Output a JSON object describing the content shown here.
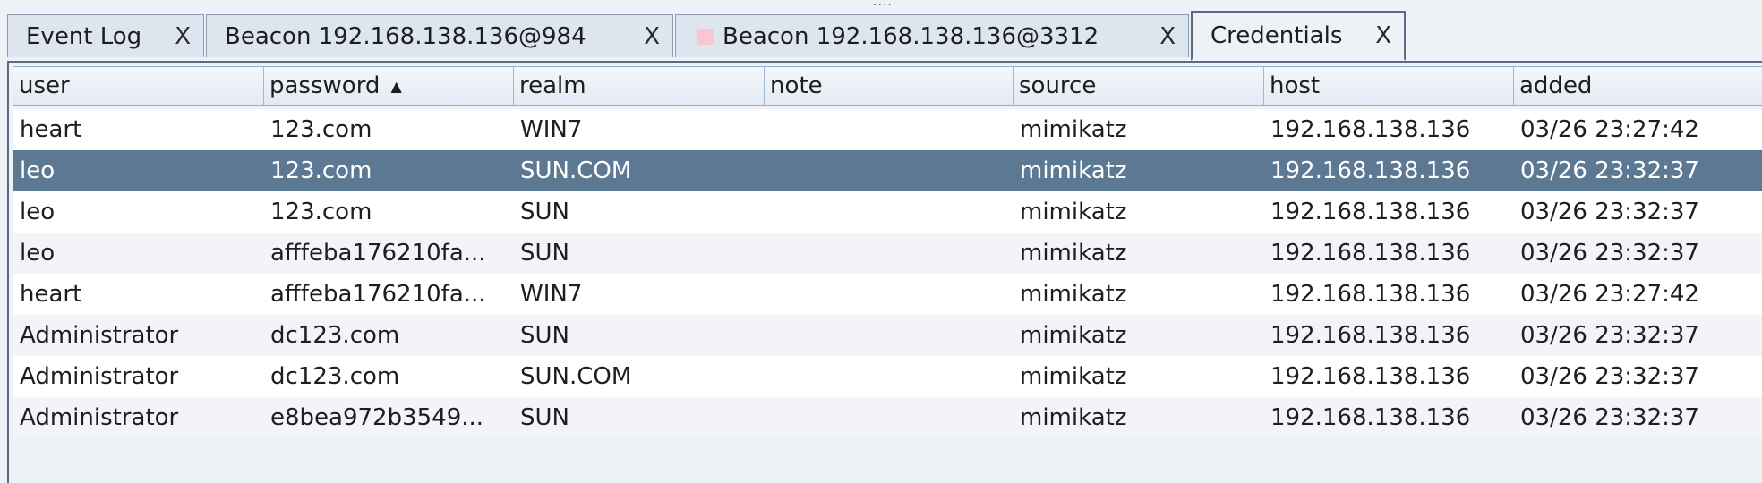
{
  "grip": "....",
  "tabs": [
    {
      "label": "Event Log",
      "close": "X"
    },
    {
      "label": "Beacon 192.168.138.136@984",
      "close": "X"
    },
    {
      "label": "Beacon 192.168.138.136@3312",
      "close": "X"
    },
    {
      "label": "Credentials",
      "close": "X"
    }
  ],
  "table": {
    "columns": [
      "user",
      "password",
      "realm",
      "note",
      "source",
      "host",
      "added"
    ],
    "sort_indicator": "▲",
    "rows": [
      [
        "heart",
        "123.com",
        "WIN7",
        "",
        "mimikatz",
        "192.168.138.136",
        "03/26 23:27:42"
      ],
      [
        "leo",
        "123.com",
        "SUN.COM",
        "",
        "mimikatz",
        "192.168.138.136",
        "03/26 23:32:37"
      ],
      [
        "leo",
        "123.com",
        "SUN",
        "",
        "mimikatz",
        "192.168.138.136",
        "03/26 23:32:37"
      ],
      [
        "leo",
        "afffeba176210fa...",
        "SUN",
        "",
        "mimikatz",
        "192.168.138.136",
        "03/26 23:32:37"
      ],
      [
        "heart",
        "afffeba176210fa...",
        "WIN7",
        "",
        "mimikatz",
        "192.168.138.136",
        "03/26 23:27:42"
      ],
      [
        "Administrator",
        "dc123.com",
        "SUN",
        "",
        "mimikatz",
        "192.168.138.136",
        "03/26 23:32:37"
      ],
      [
        "Administrator",
        "dc123.com",
        "SUN.COM",
        "",
        "mimikatz",
        "192.168.138.136",
        "03/26 23:32:37"
      ],
      [
        "Administrator",
        "e8bea972b3549...",
        "SUN",
        "",
        "mimikatz",
        "192.168.138.136",
        "03/26 23:32:37"
      ]
    ]
  }
}
